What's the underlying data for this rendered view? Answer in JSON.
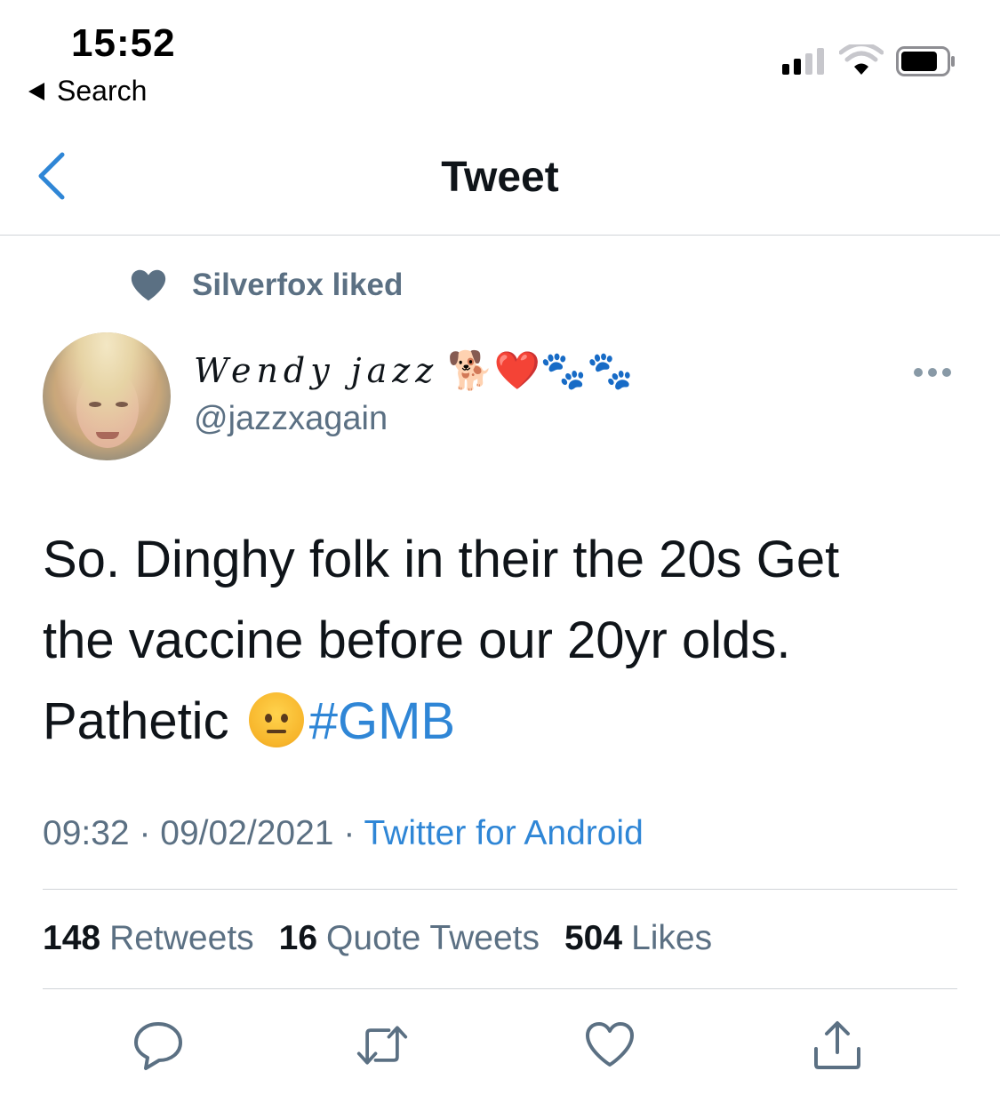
{
  "status_bar": {
    "time": "15:52",
    "back_label": "Search"
  },
  "nav": {
    "title": "Tweet"
  },
  "social_context": {
    "text": "Silverfox liked"
  },
  "tweet": {
    "author_name": "Wendy jazz",
    "author_emojis": "🐕❤️🐾🐾",
    "author_handle": "@jazzxagain",
    "text_line1": "So. Dinghy folk in their  the 20s Get",
    "text_line2": "the vaccine before our 20yr olds.",
    "text_line3": "Pathetic",
    "hashtag": "#GMB",
    "time": "09:32",
    "date": "09/02/2021",
    "separator": "·",
    "source": "Twitter for Android",
    "stats": {
      "retweets_count": "148",
      "retweets_label": "Retweets",
      "quotes_count": "16",
      "quotes_label": "Quote Tweets",
      "likes_count": "504",
      "likes_label": "Likes"
    }
  },
  "colors": {
    "link": "#2f86d6",
    "secondary_text": "#5b7083",
    "heart_icon": "#5b7083"
  },
  "icons": [
    "back-chevron-icon",
    "heart-icon",
    "more-icon",
    "reply-icon",
    "retweet-icon",
    "like-icon",
    "share-icon"
  ]
}
